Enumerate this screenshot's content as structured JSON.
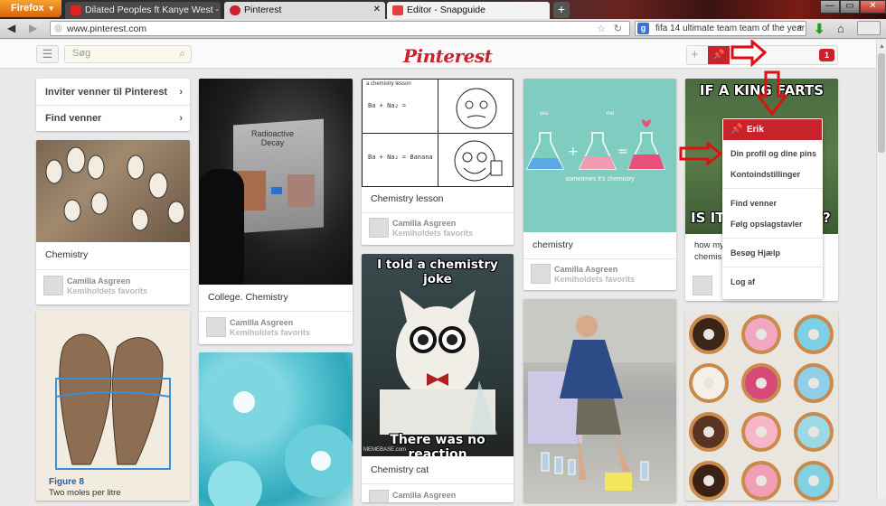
{
  "browser": {
    "app_button": "Firefox",
    "tabs": [
      {
        "title": "Dilated Peoples ft Kanye West - Thi...",
        "state": "inactive",
        "icon": "youtube-icon"
      },
      {
        "title": "Pinterest",
        "state": "active",
        "icon": "pinterest-icon"
      },
      {
        "title": "Editor - Snapguide",
        "state": "plain",
        "icon": "snapguide-icon"
      }
    ],
    "new_tab": "+",
    "url": "www.pinterest.com",
    "search_engine": "g",
    "search_query": "fifa 14 ultimate team team of the year",
    "window_buttons": [
      "—",
      "▭",
      "✕"
    ]
  },
  "pinterest": {
    "logo": "Pinterest",
    "search_placeholder": "Søg",
    "username": "Erik",
    "notifications": "1",
    "accent": "#c8232c",
    "sidebar": {
      "invite": "Inviter venner til Pinterest",
      "find": "Find venner"
    },
    "dropdown": {
      "header": "Erik",
      "items": [
        "Din profil og dine pins",
        "Kontoindstillinger",
        "Find venner",
        "Følg opslagstavler",
        "Besøg Hjælp",
        "Log af"
      ]
    },
    "pins": [
      {
        "desc": "Chemistry",
        "user": "Camilla Asgreen",
        "board": "Kemiholdets favorits"
      },
      {
        "desc": "College. Chemistry",
        "user": "Camilla Asgreen",
        "board": "Kemiholdets favorits"
      },
      {
        "desc": "Chemistry lesson",
        "user": "Camilla Asgreen",
        "board": "Kemiholdets favorits"
      },
      {
        "desc": "chemistry",
        "user": "Camilla Asgreen",
        "board": "Kemiholdets favorits"
      },
      {
        "desc": "how my chemis",
        "user": "",
        "board": ""
      },
      {
        "desc": "Chemistry cat",
        "user": "Camilla Asgreen",
        "board": ""
      }
    ],
    "image_text": {
      "projector_slide": "Radioactive\nDecay",
      "comic_caption": "a chemistry lesson",
      "comic_formula_1": "Ba + Na₂ =",
      "comic_formula_2": "Ba + Na₂ = Banana",
      "beakers_caption": "sometimes it's chemistry",
      "beakers_you": "you",
      "beakers_me": "me",
      "meme_top": "IF A KING FARTS",
      "meme_bottom": "IS IT",
      "meme_bottom_end": "?",
      "cat_top": "I told a chemistry joke",
      "cat_bottom": "There was no reaction",
      "cat_watermark": "MEMEBASE.com",
      "moles_figure": "Figure 8",
      "moles_caption": "Two moles per litre"
    }
  }
}
